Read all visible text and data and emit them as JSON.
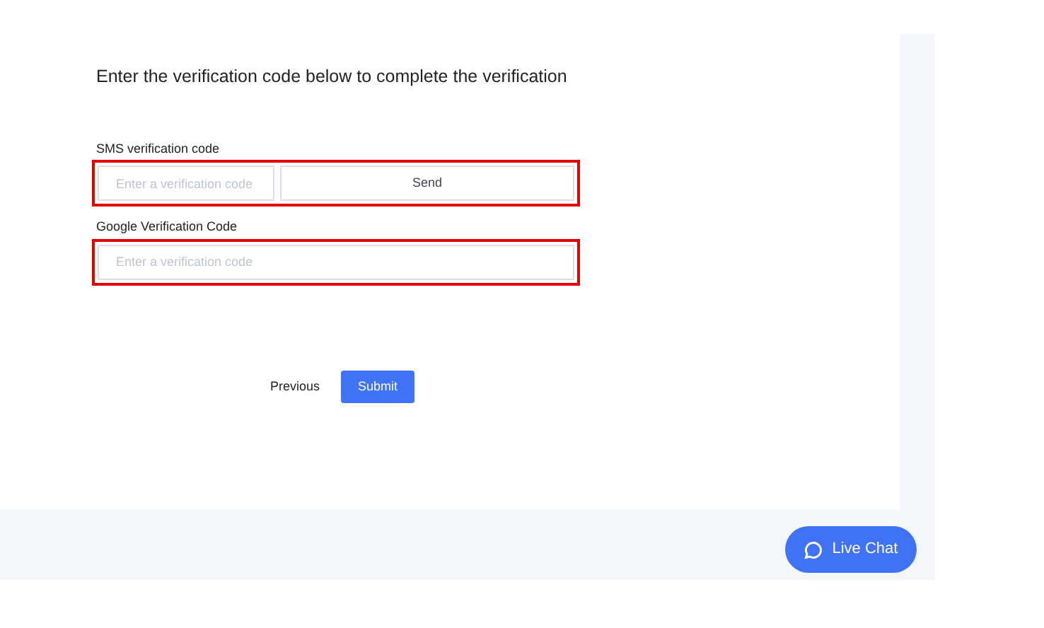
{
  "heading": "Enter the verification code below to complete the verification",
  "fields": [
    {
      "kind": "sms",
      "label": "SMS verification code",
      "placeholder": "Enter a verification code",
      "button": "Send",
      "highlighted": true
    },
    {
      "kind": "plain",
      "label": "Google Verification Code",
      "placeholder": "Enter a verification code",
      "highlighted": true
    }
  ],
  "actions": {
    "previous": "Previous",
    "submit": "Submit"
  },
  "live_chat": "Live Chat"
}
